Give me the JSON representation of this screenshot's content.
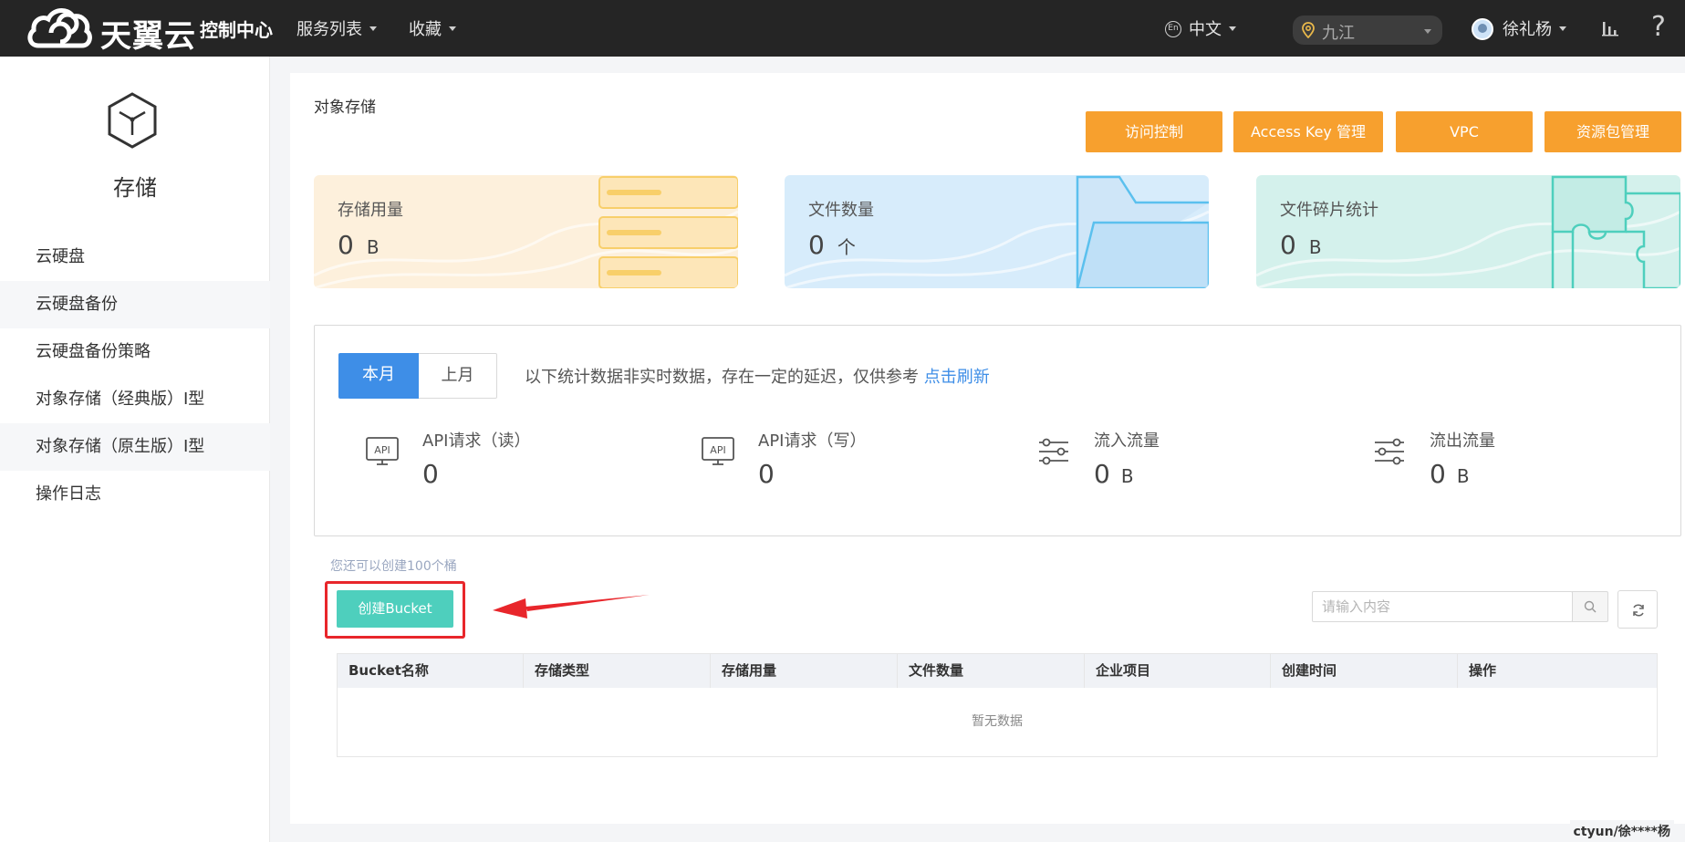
{
  "topbar": {
    "brand": "天翼云",
    "console_title": "控制中心",
    "menu": [
      "服务列表",
      "收藏"
    ],
    "language": "中文",
    "region": "九江",
    "user": "徐礼杨",
    "help": "?"
  },
  "sidebar": {
    "title": "存储",
    "items": [
      "云硬盘",
      "云硬盘备份",
      "云硬盘备份策略",
      "对象存储（经典版）Ⅰ型",
      "对象存储（原生版）Ⅰ型",
      "操作日志"
    ]
  },
  "main": {
    "page_title": "对象存储",
    "action_buttons": [
      "访问控制",
      "Access Key 管理",
      "VPC",
      "资源包管理"
    ],
    "cards": [
      {
        "label": "存储用量",
        "value": "0",
        "unit": "B"
      },
      {
        "label": "文件数量",
        "value": "0",
        "unit": "个"
      },
      {
        "label": "文件碎片统计",
        "value": "0",
        "unit": "B"
      }
    ],
    "tabs": [
      "本月",
      "上月"
    ],
    "notice": "以下统计数据非实时数据，存在一定的延迟，仅供参考",
    "refresh_link": "点击刷新",
    "stats": [
      {
        "label": "API请求（读）",
        "value": "0",
        "unit": ""
      },
      {
        "label": "API请求（写）",
        "value": "0",
        "unit": ""
      },
      {
        "label": "流入流量",
        "value": "0",
        "unit": "B"
      },
      {
        "label": "流出流量",
        "value": "0",
        "unit": "B"
      }
    ],
    "api_icon_text": "API",
    "quota_text": "您还可以创建100个桶",
    "create_button": "创建Bucket",
    "search_placeholder": "请输入内容",
    "table_headers": [
      "Bucket名称",
      "存储类型",
      "存储用量",
      "文件数量",
      "企业项目",
      "创建时间",
      "操作"
    ],
    "empty_text": "暂无数据"
  },
  "footer_user": "ctyun/徐****杨",
  "colors": {
    "topbar": "#252525",
    "orange": "#f7a02e",
    "blue": "#3e8ee7",
    "teal": "#4ecfbd",
    "highlight": "#e8262b"
  }
}
